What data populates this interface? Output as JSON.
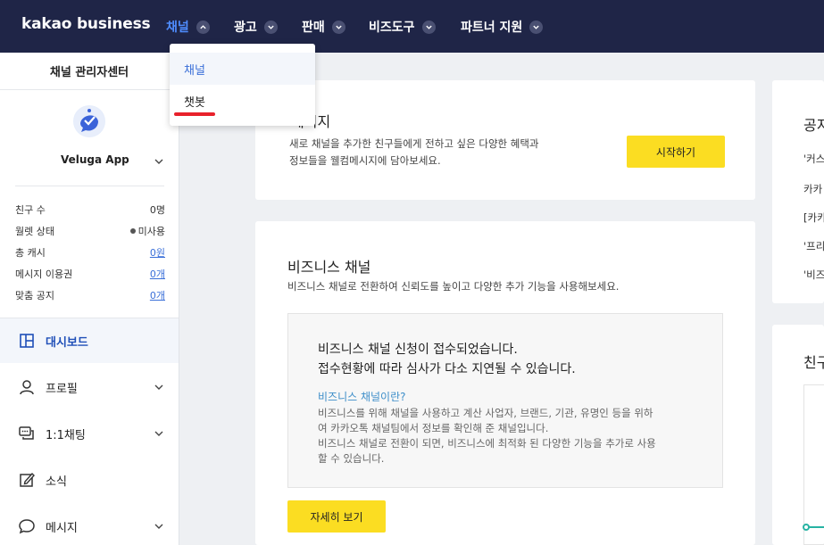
{
  "header": {
    "logo": "kakao business",
    "nav": [
      {
        "label": "채널",
        "active": true
      },
      {
        "label": "광고",
        "active": false
      },
      {
        "label": "판매",
        "active": false
      },
      {
        "label": "비즈도구",
        "active": false
      },
      {
        "label": "파트너 지원",
        "active": false
      }
    ]
  },
  "dropdown": {
    "items": [
      "채널",
      "챗봇"
    ]
  },
  "sidebar": {
    "title": "채널 관리자센터",
    "app_name": "Veluga App",
    "stats": [
      {
        "label": "친구 수",
        "value": "0명"
      },
      {
        "label": "월렛 상태",
        "value": "미사용"
      },
      {
        "label": "총 캐시",
        "value": "0원"
      },
      {
        "label": "메시지 이용권",
        "value": "0개"
      },
      {
        "label": "맞춤 공지",
        "value": "0개"
      }
    ],
    "menu": [
      {
        "label": "대시보드",
        "icon": "dashboard-icon"
      },
      {
        "label": "프로필",
        "icon": "person-icon"
      },
      {
        "label": "1:1채팅",
        "icon": "chat-icon"
      },
      {
        "label": "소식",
        "icon": "edit-icon"
      },
      {
        "label": "메시지",
        "icon": "speech-bubble-icon"
      }
    ]
  },
  "welcome_card": {
    "title_visible": "메시지",
    "desc_line1": "새로 채널을 추가한 친구들에게 전하고 싶은 다양한 혜택과",
    "desc_line2": "정보들을 웰컴메시지에 담아보세요.",
    "button": "시작하기"
  },
  "business_card": {
    "title": "비즈니스 채널",
    "subtitle": "비즈니스 채널로 전환하여 신뢰도를 높이고 다양한 추가 기능을 사용해보세요.",
    "notice_line1": "비즈니스 채널 신청이 접수되었습니다.",
    "notice_line2": "접수현황에 따라 심사가 다소 지연될 수 있습니다.",
    "link": "비즈니스 채널이란?",
    "desc_line1": "비즈니스를 위해 채널을 사용하고 계산 사업자, 브랜드, 기관, 유명인 등을 위하",
    "desc_line2": "여 카카오톡 채널팀에서 정보를 확인해 준 채널입니다.",
    "desc_line3": "비즈니스 채널로 전환이 되면, 비즈니스에 최적화 된 다양한 기능을 추가로 사용",
    "desc_line4": "할 수 있습니다.",
    "button": "자세히 보기"
  },
  "right_card": {
    "title": "공지",
    "lines": [
      "'커스",
      "카카",
      "[카카",
      "'프리",
      "'비즈"
    ]
  },
  "right_card2": {
    "title": "친구"
  },
  "colors": {
    "nav_bg": "#1f2547",
    "accent": "#3a6fd8",
    "yellow": "#fbdd22",
    "underline_red": "#e8212b"
  }
}
